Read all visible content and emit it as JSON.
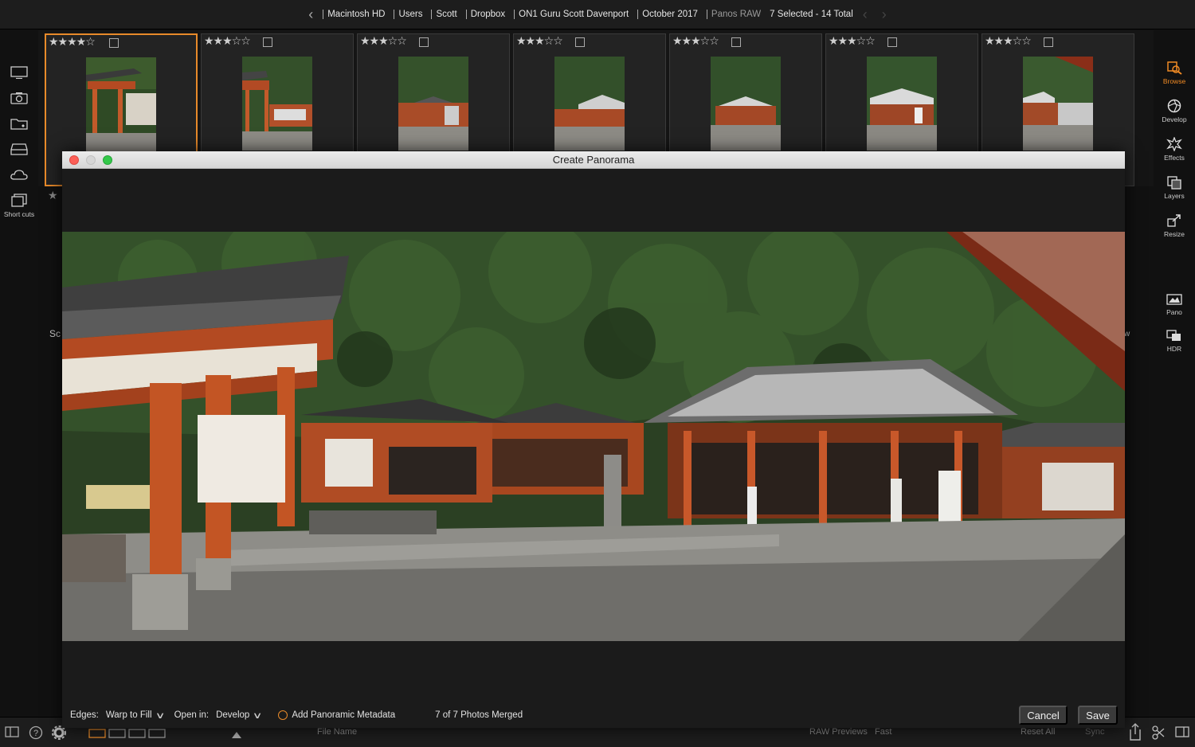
{
  "path_bar": {
    "back_icon": "chevron-left-icon",
    "crumbs": [
      "Macintosh HD",
      "Users",
      "Scott",
      "Dropbox",
      "ON1 Guru Scott Davenport",
      "October 2017"
    ],
    "current_folder": "Panos RAW",
    "selection": "7 Selected - 14 Total",
    "nav_prev_icon": "chevron-left-icon",
    "nav_next_icon": "chevron-right-icon"
  },
  "left_sidebar": {
    "items": [
      {
        "icon": "monitor-icon"
      },
      {
        "icon": "camera-icon"
      },
      {
        "icon": "folder-heart-icon"
      },
      {
        "icon": "drive-icon"
      },
      {
        "icon": "cloud-icon"
      },
      {
        "icon": "shortcuts-icon",
        "label": "Short cuts"
      }
    ]
  },
  "right_sidebar": {
    "items": [
      {
        "label": "Browse",
        "icon": "browse-icon",
        "active": true
      },
      {
        "label": "Develop",
        "icon": "develop-icon"
      },
      {
        "label": "Effects",
        "icon": "effects-icon"
      },
      {
        "label": "Layers",
        "icon": "layers-icon"
      },
      {
        "label": "Resize",
        "icon": "resize-icon"
      },
      {
        "label": "Pano",
        "icon": "pano-icon"
      },
      {
        "label": "HDR",
        "icon": "hdr-icon"
      }
    ]
  },
  "filmstrip": {
    "thumbnails": [
      {
        "stars": "★★★★☆",
        "rating": 4,
        "selected": true
      },
      {
        "stars": "★★★☆☆",
        "rating": 3,
        "selected": false
      },
      {
        "stars": "★★★☆☆",
        "rating": 3,
        "selected": false
      },
      {
        "stars": "★★★☆☆",
        "rating": 3,
        "selected": false
      },
      {
        "stars": "★★★☆☆",
        "rating": 3,
        "selected": false
      },
      {
        "stars": "★★★☆☆",
        "rating": 3,
        "selected": false
      },
      {
        "stars": "★★★☆☆",
        "rating": 3,
        "selected": false
      }
    ]
  },
  "background_fragments": {
    "left": "Sc",
    "right": "w",
    "stars": "★"
  },
  "dialog": {
    "title": "Create Panorama",
    "edges_label": "Edges:",
    "edges_value": "Warp to Fill",
    "open_in_label": "Open in:",
    "open_in_value": "Develop",
    "metadata_option": "Add Panoramic Metadata",
    "merge_status": "7 of 7 Photos Merged",
    "cancel_label": "Cancel",
    "save_label": "Save"
  },
  "bottom_bar": {
    "sort_label": "File Name",
    "raw_previews_label": "RAW Previews",
    "raw_previews_value": "Fast",
    "reset_label": "Reset All",
    "sync_label": "Sync"
  },
  "colors": {
    "accent": "#e88a2a",
    "background": "#111111",
    "dialog_titlebar": "#e0e0e0"
  }
}
